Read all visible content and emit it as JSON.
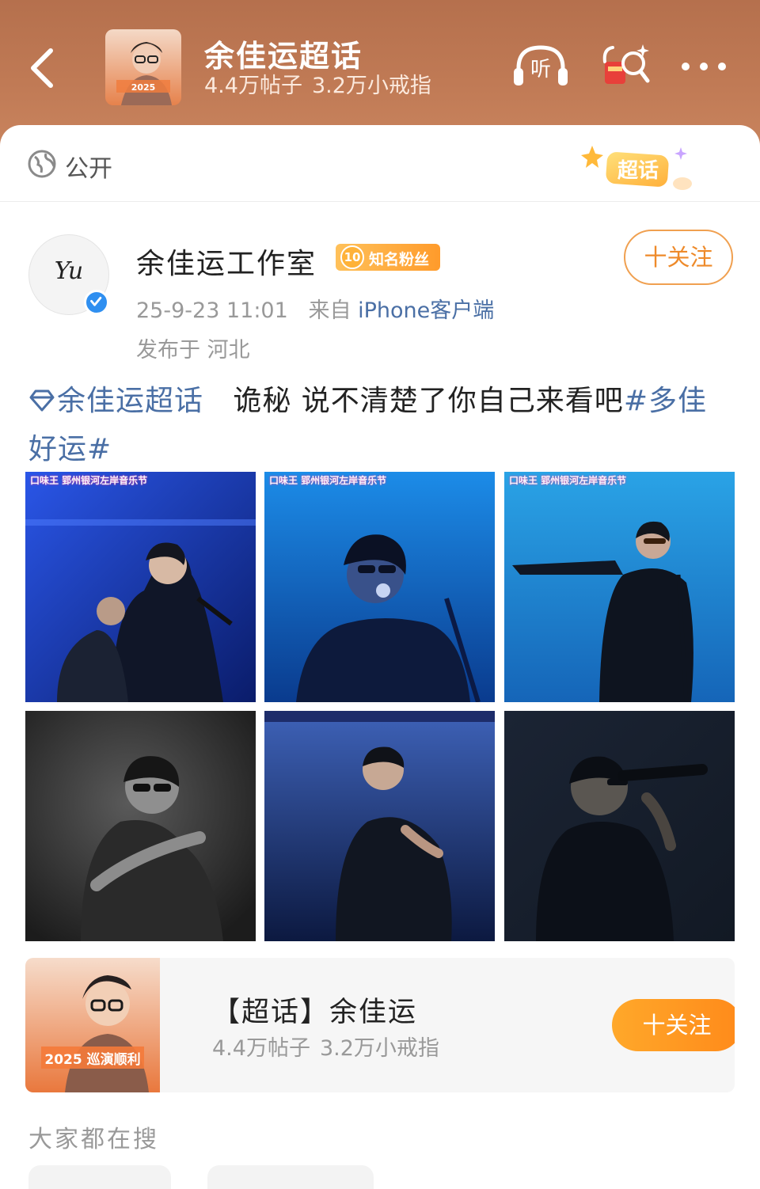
{
  "header": {
    "title": "余佳运超话",
    "posts_count": "4.4万帖子",
    "members_count": "3.2万小戒指",
    "listen_label": "听"
  },
  "sheet": {
    "visibility_label": "公开",
    "badge_label": "超话"
  },
  "author": {
    "name": "余佳运工作室",
    "avatar_text": "Yu",
    "fan_level": "10",
    "fan_badge": "知名粉丝",
    "follow_label": "十关注",
    "timestamp": "25-9-23 11:01",
    "source_prefix": "来自",
    "source": "iPhone客户端",
    "location": "发布于 河北"
  },
  "post": {
    "topic_link": "余佳运超话",
    "body": "诡秘 说不清楚了你自己来看吧",
    "hashtag": "#多佳好运#"
  },
  "photos": [
    {
      "alt": "stage-photo-1",
      "banner": "口味王 郢州银河左岸音乐节"
    },
    {
      "alt": "stage-photo-2",
      "banner": "口味王 郢州银河左岸音乐节"
    },
    {
      "alt": "stage-photo-3",
      "banner": "口味王 郢州银河左岸音乐节"
    },
    {
      "alt": "stage-photo-4",
      "banner": ""
    },
    {
      "alt": "stage-photo-5",
      "banner": ""
    },
    {
      "alt": "stage-photo-6",
      "banner": ""
    }
  ],
  "topic_card": {
    "title": "【超话】余佳运",
    "posts_count": "4.4万帖子",
    "members_count": "3.2万小戒指",
    "follow_label": "十关注",
    "thumb_caption": "2025 巡演顺利"
  },
  "search_hint": "大家都在搜",
  "colors": {
    "header": "#c07a55",
    "link": "#4a6fa5",
    "accent": "#ff8a1a"
  }
}
